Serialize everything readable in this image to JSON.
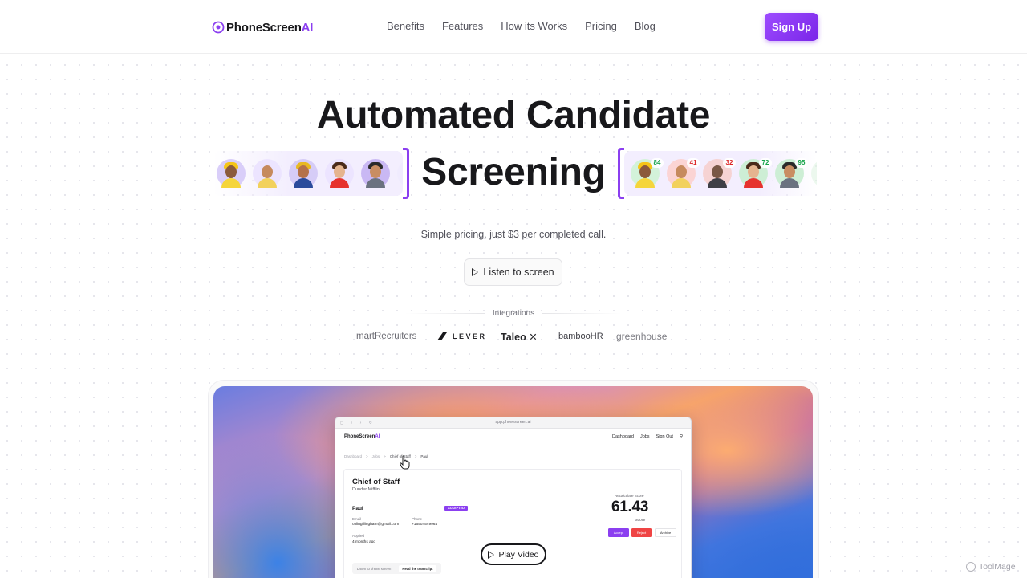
{
  "brand": {
    "name_main": "PhoneScreen",
    "name_accent": "AI",
    "accent": "#8b3ff0"
  },
  "nav": {
    "links": [
      "Benefits",
      "Features",
      "How its Works",
      "Pricing",
      "Blog"
    ],
    "signup": "Sign Up"
  },
  "hero": {
    "title": "Automated Candidate",
    "rotating_word": "Screening",
    "subtitle": "Simple pricing, just $3 per completed call.",
    "listen_button": "Listen to screen",
    "scored_badges": [
      "84",
      "41",
      "32",
      "72",
      "95"
    ]
  },
  "integrations": {
    "label": "Integrations",
    "logos": [
      "martRecruiters",
      "LEVER",
      "Taleo",
      "bambooHR",
      "greenhouse"
    ]
  },
  "preview": {
    "url": "app.phonescreen.ai",
    "logo_main": "PhoneScreen",
    "logo_accent": "AI",
    "nav": [
      "Dashboard",
      "Jobs",
      "Sign Out"
    ],
    "breadcrumb": [
      "Dashboard",
      "Jobs",
      "Chief of Staff",
      "Paul"
    ],
    "job_title": "Chief of Staff",
    "company": "Dunder Mifflin",
    "candidate": "Paul",
    "status": "ACCEPTED",
    "email_label": "Email",
    "email": "colingillingham@gmail.com",
    "phone_label": "Phone",
    "phone": "+16504549964",
    "applied_label": "Applied",
    "applied": "4 months ago",
    "score_label": "Recalculate Score",
    "score": "61.43",
    "score_sub": "score",
    "actions": [
      "Accept",
      "Reject",
      "Archive"
    ],
    "tabs": [
      "Listen to phone screen",
      "Read the transcript"
    ],
    "play_video": "Play Video"
  },
  "watermark": "ToolMage"
}
